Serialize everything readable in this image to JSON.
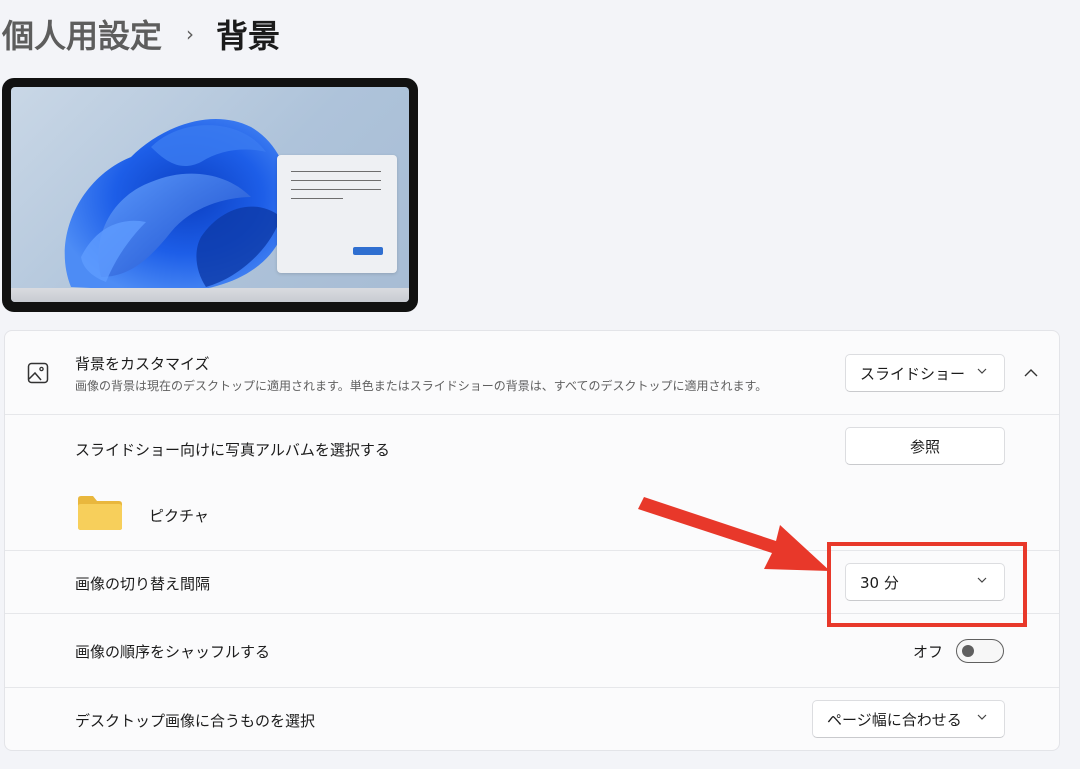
{
  "breadcrumb": {
    "parent": "個人用設定",
    "separator": "›",
    "current": "背景"
  },
  "customize": {
    "title": "背景をカスタマイズ",
    "description": "画像の背景は現在のデスクトップに適用されます。単色またはスライドショーの背景は、すべてのデスクトップに適用されます。",
    "dropdown_value": "スライドショー"
  },
  "album": {
    "label": "スライドショー向けに写真アルバムを選択する",
    "browse_label": "参照",
    "folder_name": "ピクチャ"
  },
  "interval": {
    "label": "画像の切り替え間隔",
    "dropdown_value": "30 分"
  },
  "shuffle": {
    "label": "画像の順序をシャッフルする",
    "state_label": "オフ",
    "enabled": false
  },
  "fit": {
    "label": "デスクトップ画像に合うものを選択",
    "dropdown_value": "ページ幅に合わせる"
  },
  "colors": {
    "annotation": "#e8382a",
    "folder": "#f7cf5b",
    "accent": "#2f6fd0"
  }
}
